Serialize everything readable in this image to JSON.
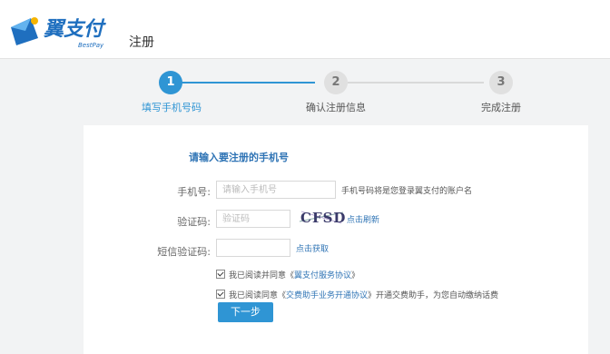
{
  "header": {
    "logo_text": "翼支付",
    "logo_sub": "BestPay",
    "page_title": "注册"
  },
  "steps": [
    {
      "num": "1",
      "label": "填写手机号码",
      "active": true
    },
    {
      "num": "2",
      "label": "确认注册信息",
      "active": false
    },
    {
      "num": "3",
      "label": "完成注册",
      "active": false
    }
  ],
  "form": {
    "heading": "请输入要注册的手机号",
    "phone": {
      "label": "手机号:",
      "placeholder": "请输入手机号",
      "hint": "手机号码将是您登录翼支付的账户名"
    },
    "captcha": {
      "label": "验证码:",
      "placeholder": "验证码",
      "image_text": "CFSD",
      "refresh_link": "点击刷新"
    },
    "sms": {
      "label": "短信验证码:",
      "get_link": "点击获取"
    },
    "agree1": {
      "prefix": "我已阅读并同意《",
      "link": "翼支付服务协议",
      "suffix": "》"
    },
    "agree2": {
      "prefix": "我已阅读同意《",
      "link": "交费助手业务开通协议",
      "suffix": "》开通交费助手，为您自动缴纳话费"
    },
    "next_label": "下一步"
  },
  "colors": {
    "accent": "#2f95d4",
    "link": "#2f74b5"
  }
}
